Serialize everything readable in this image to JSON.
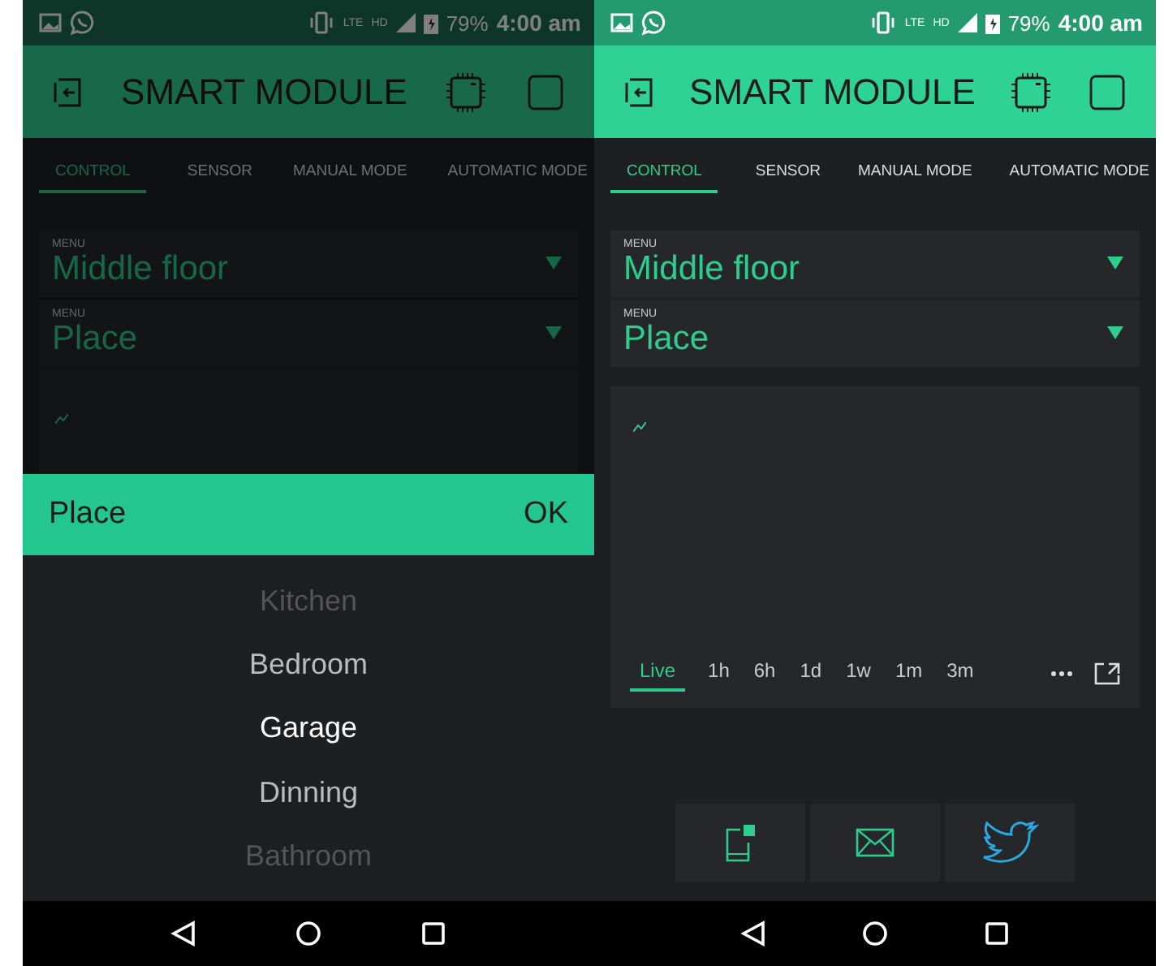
{
  "screens": [
    {
      "dimmed": true,
      "status_bar": {
        "network": "LTE",
        "hd": "HD",
        "battery": "79%",
        "time": "4:00 am"
      },
      "header": {
        "title": "SMART MODULE"
      },
      "tabs": [
        {
          "label": "CONTROL",
          "selected": true
        },
        {
          "label": "SENSOR",
          "selected": false
        },
        {
          "label": "MANUAL MODE",
          "selected": false
        },
        {
          "label": "AUTOMATIC MODE",
          "selected": false
        }
      ],
      "menus": [
        {
          "label": "MENU",
          "value": "Middle floor"
        },
        {
          "label": "MENU",
          "value": "Place"
        }
      ],
      "picker": {
        "title": "Place",
        "ok": "OK",
        "options": [
          {
            "label": "Kitchen",
            "selected": false
          },
          {
            "label": "Bedroom",
            "selected": false
          },
          {
            "label": "Garage",
            "selected": true
          },
          {
            "label": "Dinning",
            "selected": false
          },
          {
            "label": "Bathroom",
            "selected": false
          }
        ]
      }
    },
    {
      "dimmed": false,
      "status_bar": {
        "network": "LTE",
        "hd": "HD",
        "battery": "79%",
        "time": "4:00 am"
      },
      "header": {
        "title": "SMART MODULE"
      },
      "tabs": [
        {
          "label": "CONTROL",
          "selected": true
        },
        {
          "label": "SENSOR",
          "selected": false
        },
        {
          "label": "MANUAL MODE",
          "selected": false
        },
        {
          "label": "AUTOMATIC MODE",
          "selected": false
        }
      ],
      "menus": [
        {
          "label": "MENU",
          "value": "Middle floor"
        },
        {
          "label": "MENU",
          "value": "Place"
        }
      ],
      "chart": {
        "ranges": [
          {
            "label": "Live",
            "selected": true
          },
          {
            "label": "1h",
            "selected": false
          },
          {
            "label": "6h",
            "selected": false
          },
          {
            "label": "1d",
            "selected": false
          },
          {
            "label": "1w",
            "selected": false
          },
          {
            "label": "1m",
            "selected": false
          },
          {
            "label": "3m",
            "selected": false
          }
        ]
      }
    }
  ]
}
